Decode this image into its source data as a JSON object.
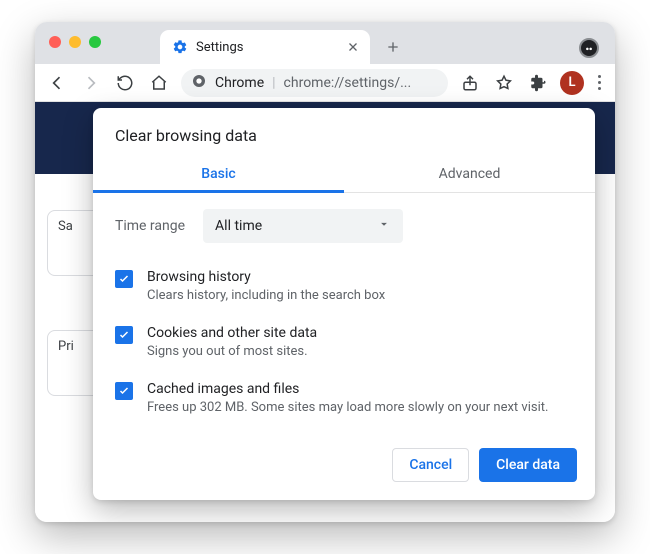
{
  "tab": {
    "title": "Settings"
  },
  "omnibox": {
    "prefix": "Chrome",
    "url_shown": "chrome://settings/..."
  },
  "avatar": {
    "initial": "L"
  },
  "bg": {
    "card1": "Sa",
    "card2": "Pri"
  },
  "dialog": {
    "title": "Clear browsing data",
    "tabs": {
      "basic": "Basic",
      "advanced": "Advanced"
    },
    "time_range_label": "Time range",
    "time_range_value": "All time",
    "options": [
      {
        "title": "Browsing history",
        "desc": "Clears history, including in the search box"
      },
      {
        "title": "Cookies and other site data",
        "desc": "Signs you out of most sites."
      },
      {
        "title": "Cached images and files",
        "desc": "Frees up 302 MB. Some sites may load more slowly on your next visit."
      }
    ],
    "actions": {
      "cancel": "Cancel",
      "confirm": "Clear data"
    }
  }
}
